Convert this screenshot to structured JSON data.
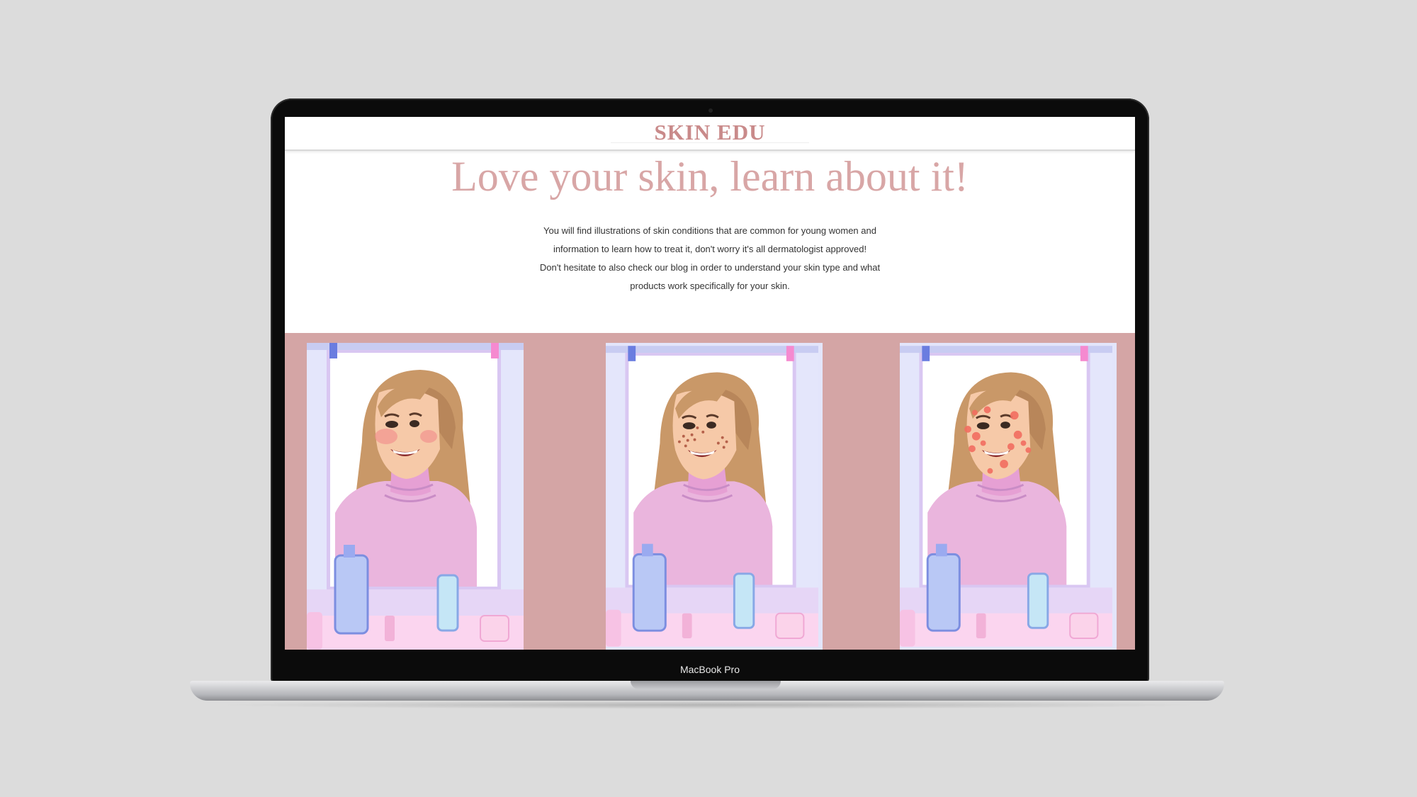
{
  "device": {
    "label": "MacBook Pro"
  },
  "site": {
    "logo": "SKIN EDU",
    "hero_title": "Love your skin, learn about it!",
    "hero_lines": [
      "You will find illustrations of skin conditions that are common for young women and",
      "information to learn how to treat it, don't worry it's all dermatologist approved!",
      "Don't hesitate to also check our blog in order to understand your skin type and what",
      "products work specifically for your skin."
    ]
  },
  "colors": {
    "accent": "#c98a8a",
    "hero": "#d8a6a6",
    "gallery_bg": "#d4a5a5",
    "sweater": "#eab5dd",
    "hair": "#c99868"
  },
  "gallery": {
    "cards": [
      {
        "condition": "redness"
      },
      {
        "condition": "freckles"
      },
      {
        "condition": "acne"
      }
    ]
  }
}
